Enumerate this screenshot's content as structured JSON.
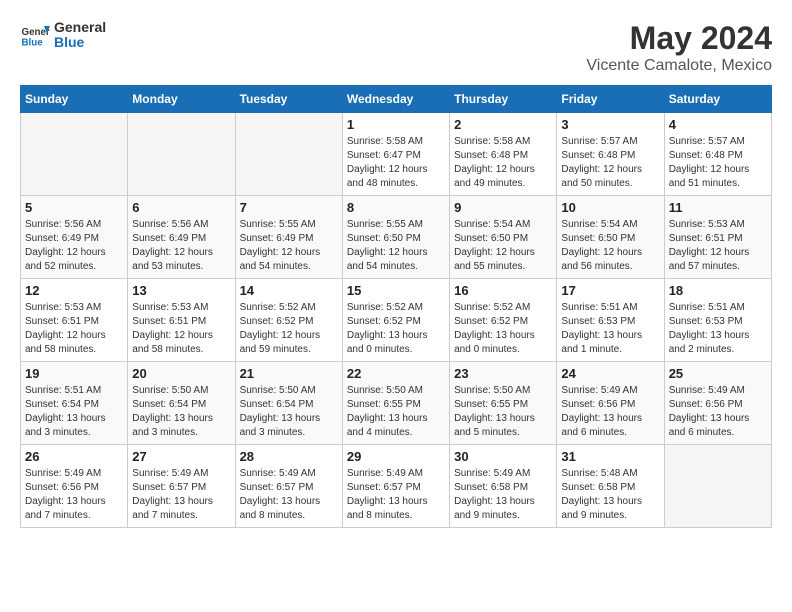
{
  "logo": {
    "line1": "General",
    "line2": "Blue"
  },
  "title": "May 2024",
  "subtitle": "Vicente Camalote, Mexico",
  "days_of_week": [
    "Sunday",
    "Monday",
    "Tuesday",
    "Wednesday",
    "Thursday",
    "Friday",
    "Saturday"
  ],
  "weeks": [
    [
      {
        "day": "",
        "info": ""
      },
      {
        "day": "",
        "info": ""
      },
      {
        "day": "",
        "info": ""
      },
      {
        "day": "1",
        "info": "Sunrise: 5:58 AM\nSunset: 6:47 PM\nDaylight: 12 hours\nand 48 minutes."
      },
      {
        "day": "2",
        "info": "Sunrise: 5:58 AM\nSunset: 6:48 PM\nDaylight: 12 hours\nand 49 minutes."
      },
      {
        "day": "3",
        "info": "Sunrise: 5:57 AM\nSunset: 6:48 PM\nDaylight: 12 hours\nand 50 minutes."
      },
      {
        "day": "4",
        "info": "Sunrise: 5:57 AM\nSunset: 6:48 PM\nDaylight: 12 hours\nand 51 minutes."
      }
    ],
    [
      {
        "day": "5",
        "info": "Sunrise: 5:56 AM\nSunset: 6:49 PM\nDaylight: 12 hours\nand 52 minutes."
      },
      {
        "day": "6",
        "info": "Sunrise: 5:56 AM\nSunset: 6:49 PM\nDaylight: 12 hours\nand 53 minutes."
      },
      {
        "day": "7",
        "info": "Sunrise: 5:55 AM\nSunset: 6:49 PM\nDaylight: 12 hours\nand 54 minutes."
      },
      {
        "day": "8",
        "info": "Sunrise: 5:55 AM\nSunset: 6:50 PM\nDaylight: 12 hours\nand 54 minutes."
      },
      {
        "day": "9",
        "info": "Sunrise: 5:54 AM\nSunset: 6:50 PM\nDaylight: 12 hours\nand 55 minutes."
      },
      {
        "day": "10",
        "info": "Sunrise: 5:54 AM\nSunset: 6:50 PM\nDaylight: 12 hours\nand 56 minutes."
      },
      {
        "day": "11",
        "info": "Sunrise: 5:53 AM\nSunset: 6:51 PM\nDaylight: 12 hours\nand 57 minutes."
      }
    ],
    [
      {
        "day": "12",
        "info": "Sunrise: 5:53 AM\nSunset: 6:51 PM\nDaylight: 12 hours\nand 58 minutes."
      },
      {
        "day": "13",
        "info": "Sunrise: 5:53 AM\nSunset: 6:51 PM\nDaylight: 12 hours\nand 58 minutes."
      },
      {
        "day": "14",
        "info": "Sunrise: 5:52 AM\nSunset: 6:52 PM\nDaylight: 12 hours\nand 59 minutes."
      },
      {
        "day": "15",
        "info": "Sunrise: 5:52 AM\nSunset: 6:52 PM\nDaylight: 13 hours\nand 0 minutes."
      },
      {
        "day": "16",
        "info": "Sunrise: 5:52 AM\nSunset: 6:52 PM\nDaylight: 13 hours\nand 0 minutes."
      },
      {
        "day": "17",
        "info": "Sunrise: 5:51 AM\nSunset: 6:53 PM\nDaylight: 13 hours\nand 1 minute."
      },
      {
        "day": "18",
        "info": "Sunrise: 5:51 AM\nSunset: 6:53 PM\nDaylight: 13 hours\nand 2 minutes."
      }
    ],
    [
      {
        "day": "19",
        "info": "Sunrise: 5:51 AM\nSunset: 6:54 PM\nDaylight: 13 hours\nand 3 minutes."
      },
      {
        "day": "20",
        "info": "Sunrise: 5:50 AM\nSunset: 6:54 PM\nDaylight: 13 hours\nand 3 minutes."
      },
      {
        "day": "21",
        "info": "Sunrise: 5:50 AM\nSunset: 6:54 PM\nDaylight: 13 hours\nand 3 minutes."
      },
      {
        "day": "22",
        "info": "Sunrise: 5:50 AM\nSunset: 6:55 PM\nDaylight: 13 hours\nand 4 minutes."
      },
      {
        "day": "23",
        "info": "Sunrise: 5:50 AM\nSunset: 6:55 PM\nDaylight: 13 hours\nand 5 minutes."
      },
      {
        "day": "24",
        "info": "Sunrise: 5:49 AM\nSunset: 6:56 PM\nDaylight: 13 hours\nand 6 minutes."
      },
      {
        "day": "25",
        "info": "Sunrise: 5:49 AM\nSunset: 6:56 PM\nDaylight: 13 hours\nand 6 minutes."
      }
    ],
    [
      {
        "day": "26",
        "info": "Sunrise: 5:49 AM\nSunset: 6:56 PM\nDaylight: 13 hours\nand 7 minutes."
      },
      {
        "day": "27",
        "info": "Sunrise: 5:49 AM\nSunset: 6:57 PM\nDaylight: 13 hours\nand 7 minutes."
      },
      {
        "day": "28",
        "info": "Sunrise: 5:49 AM\nSunset: 6:57 PM\nDaylight: 13 hours\nand 8 minutes."
      },
      {
        "day": "29",
        "info": "Sunrise: 5:49 AM\nSunset: 6:57 PM\nDaylight: 13 hours\nand 8 minutes."
      },
      {
        "day": "30",
        "info": "Sunrise: 5:49 AM\nSunset: 6:58 PM\nDaylight: 13 hours\nand 9 minutes."
      },
      {
        "day": "31",
        "info": "Sunrise: 5:48 AM\nSunset: 6:58 PM\nDaylight: 13 hours\nand 9 minutes."
      },
      {
        "day": "",
        "info": ""
      }
    ]
  ]
}
